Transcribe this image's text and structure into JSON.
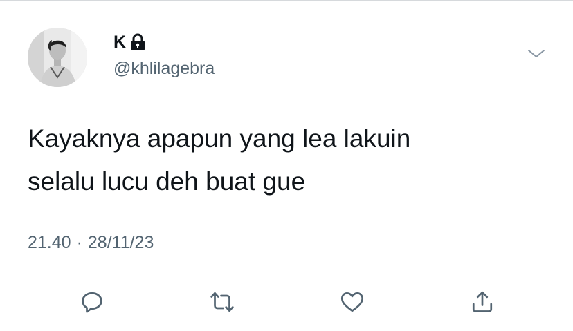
{
  "tweet": {
    "author": {
      "display_name": "K",
      "handle": "@khlilagebra",
      "protected": true
    },
    "text_lines": [
      "Kayaknya apapun yang lea lakuin",
      "selalu lucu deh buat gue"
    ],
    "time": "21.40",
    "separator": "·",
    "date": "28/11/23"
  },
  "icons": {
    "lock": "lock-icon",
    "more": "chevron-down-icon",
    "reply": "reply-icon",
    "retweet": "retweet-icon",
    "like": "heart-icon",
    "share": "share-icon"
  },
  "colors": {
    "text": "#0f1419",
    "secondary": "#536471",
    "divider": "#cfd9de"
  }
}
